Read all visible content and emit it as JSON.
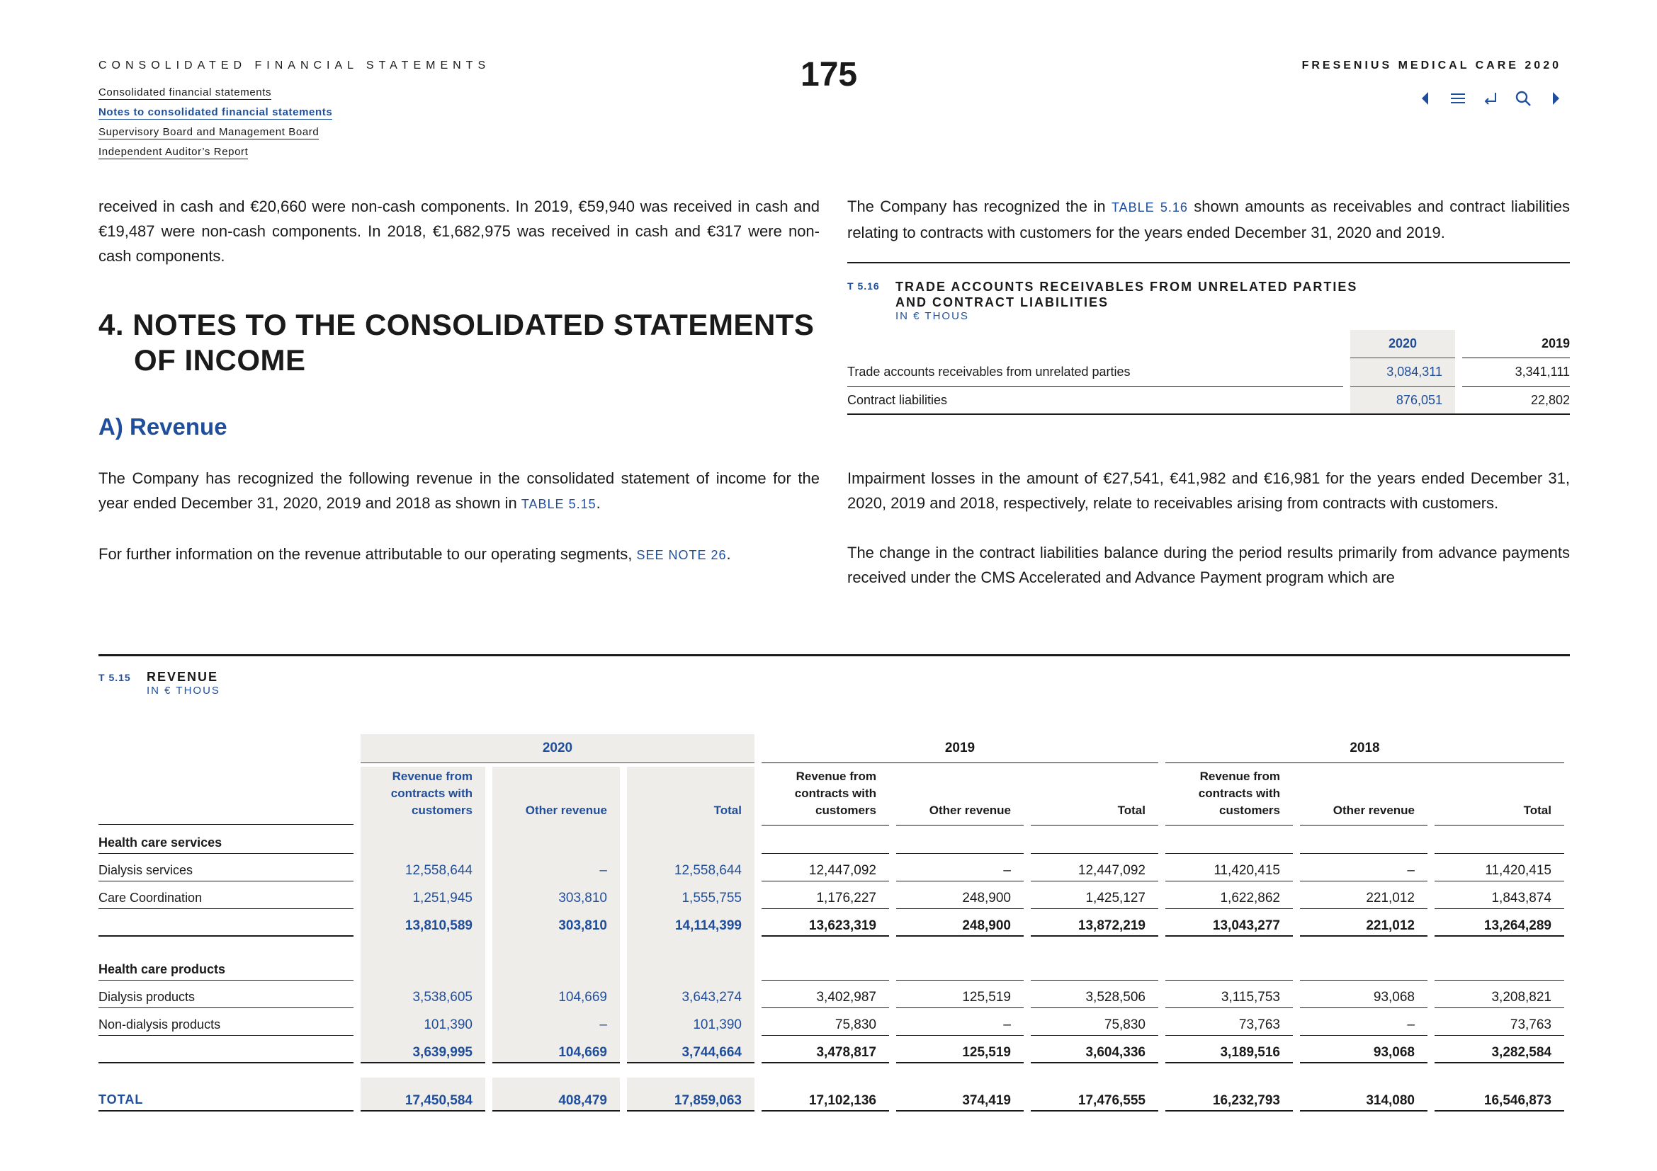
{
  "header": {
    "section": "CONSOLIDATED FINANCIAL STATEMENTS",
    "page_number": "175",
    "company": "FRESENIUS MEDICAL CARE 2020",
    "nav": [
      "Consolidated financial statements",
      "Notes to consolidated financial statements",
      "Supervisory Board and Management Board",
      "Independent Auditor’s Report"
    ]
  },
  "left": {
    "intro": "received in cash and €20,660 were non-cash components. In 2019, €59,940 was received in cash and €19,487 were non-cash components. In 2018, €1,682,975 was received in cash and €317 were non-cash components.",
    "heading_line1": "4. NOTES TO THE CONSOLIDATED STATEMENTS",
    "heading_line2": "OF INCOME",
    "subheading": "A) Revenue",
    "para1_a": "The Company has recognized the following revenue in the consolidated statement of income for the year ended December 31, 2020, 2019 and 2018 as shown in ",
    "para1_ref": "TABLE 5.15",
    "para1_b": ".",
    "para2_a": "For further information on the revenue attributable to our operating segments, ",
    "para2_ref": "SEE NOTE 26",
    "para2_b": "."
  },
  "right": {
    "para1_a": "The Company has recognized the in ",
    "para1_ref": "TABLE 5.16",
    "para1_b": " shown amounts as receivables and contract liabilities relating to contracts with customers for the years ended December 31, 2020 and 2019.",
    "para2": "Impairment losses in the amount of €27,541, €41,982 and €16,981 for the years ended December 31, 2020, 2019 and 2018, respectively, relate to receivables arising from contracts with customers.",
    "para3": "The change in the contract liabilities balance during the period results primarily from advance payments received under the CMS Accelerated and Advance Payment program which are"
  },
  "table516": {
    "label": "T 5.16",
    "title_line1": "TRADE ACCOUNTS RECEIVABLES FROM UNRELATED PARTIES",
    "title_line2": "AND CONTRACT LIABILITIES",
    "unit": "IN € THOUS",
    "col_2020": "2020",
    "col_2019": "2019",
    "rows": [
      {
        "label": "Trade accounts receivables from unrelated parties",
        "v2020": "3,084,311",
        "v2019": "3,341,111"
      },
      {
        "label": "Contract liabilities",
        "v2020": "876,051",
        "v2019": "22,802"
      }
    ]
  },
  "table515": {
    "label": "T 5.15",
    "title": "REVENUE",
    "unit": "IN € THOUS",
    "years": [
      "2020",
      "2019",
      "2018"
    ],
    "subcols": [
      "Revenue from contracts with customers",
      "Other revenue",
      "Total"
    ],
    "rows": [
      {
        "type": "section",
        "label": "Health care services",
        "values": [
          "",
          "",
          "",
          "",
          "",
          "",
          "",
          "",
          ""
        ]
      },
      {
        "type": "row",
        "label": "Dialysis services",
        "values": [
          "12,558,644",
          "–",
          "12,558,644",
          "12,447,092",
          "–",
          "12,447,092",
          "11,420,415",
          "–",
          "11,420,415"
        ]
      },
      {
        "type": "row",
        "label": "Care Coordination",
        "values": [
          "1,251,945",
          "303,810",
          "1,555,755",
          "1,176,227",
          "248,900",
          "1,425,127",
          "1,622,862",
          "221,012",
          "1,843,874"
        ]
      },
      {
        "type": "subtotal",
        "label": "",
        "values": [
          "13,810,589",
          "303,810",
          "14,114,399",
          "13,623,319",
          "248,900",
          "13,872,219",
          "13,043,277",
          "221,012",
          "13,264,289"
        ]
      },
      {
        "type": "section",
        "label": "Health care products",
        "values": [
          "",
          "",
          "",
          "",
          "",
          "",
          "",
          "",
          ""
        ]
      },
      {
        "type": "row",
        "label": "Dialysis products",
        "values": [
          "3,538,605",
          "104,669",
          "3,643,274",
          "3,402,987",
          "125,519",
          "3,528,506",
          "3,115,753",
          "93,068",
          "3,208,821"
        ]
      },
      {
        "type": "row",
        "label": "Non-dialysis products",
        "values": [
          "101,390",
          "–",
          "101,390",
          "75,830",
          "–",
          "75,830",
          "73,763",
          "–",
          "73,763"
        ]
      },
      {
        "type": "subtotal",
        "label": "",
        "values": [
          "3,639,995",
          "104,669",
          "3,744,664",
          "3,478,817",
          "125,519",
          "3,604,336",
          "3,189,516",
          "93,068",
          "3,282,584"
        ]
      },
      {
        "type": "total",
        "label": "TOTAL",
        "values": [
          "17,450,584",
          "408,479",
          "17,859,063",
          "17,102,136",
          "374,419",
          "17,476,555",
          "16,232,793",
          "314,080",
          "16,546,873"
        ]
      }
    ]
  },
  "icons": [
    "prev-page-icon",
    "menu-icon",
    "back-icon",
    "search-icon",
    "next-page-icon"
  ]
}
